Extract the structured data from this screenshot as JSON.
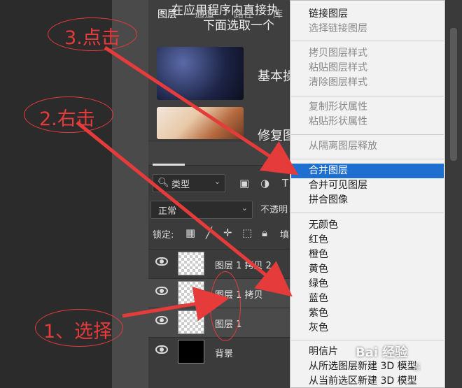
{
  "colors": {
    "annotation": "#e53b3b",
    "menu_highlight": "#1f6fd1",
    "menu_bg": "#f2f2f2",
    "panel_bg": "#3b3b3b"
  },
  "banner": {
    "line1": "在应用程序内直接执",
    "line2": "下面选取一个",
    "item1_label": "基本操",
    "item2_label": "修复图"
  },
  "layers_panel": {
    "tabs": [
      "图层",
      "通道",
      "路径",
      "库"
    ],
    "active_tab": "图层",
    "filter_label": "类型",
    "filter_icons": [
      "image-filter-icon",
      "adjustment-filter-icon",
      "type-filter-icon"
    ],
    "blend_mode": "正常",
    "opacity_label": "不透明",
    "lock_label": "锁定:",
    "lock_icons": [
      "lock-pixels-icon",
      "lock-brush-icon",
      "lock-position-icon",
      "lock-artboard-icon",
      "lock-all-icon"
    ],
    "fill_label": "填",
    "layers": [
      {
        "name": "图层 1 拷贝 2",
        "thumb": "transparent",
        "selected": false
      },
      {
        "name": "图层 1 拷贝",
        "thumb": "transparent",
        "selected": true
      },
      {
        "name": "图层 1",
        "thumb": "transparent",
        "selected": true
      },
      {
        "name": "背景",
        "thumb": "black",
        "selected": false
      }
    ]
  },
  "context_menu": {
    "groups": [
      [
        {
          "label": "链接图层",
          "enabled": true
        },
        {
          "label": "选择链接图层",
          "enabled": false
        }
      ],
      [
        {
          "label": "拷贝图层样式",
          "enabled": false
        },
        {
          "label": "粘贴图层样式",
          "enabled": false
        },
        {
          "label": "清除图层样式",
          "enabled": false
        }
      ],
      [
        {
          "label": "复制形状属性",
          "enabled": false
        },
        {
          "label": "粘贴形状属性",
          "enabled": false
        }
      ],
      [
        {
          "label": "从隔离图层释放",
          "enabled": false
        }
      ],
      [
        {
          "label": "合并图层",
          "enabled": true,
          "highlighted": true
        },
        {
          "label": "合并可见图层",
          "enabled": true
        },
        {
          "label": "拼合图像",
          "enabled": true
        }
      ],
      [
        {
          "label": "无颜色",
          "enabled": true
        },
        {
          "label": "红色",
          "enabled": true
        },
        {
          "label": "橙色",
          "enabled": true
        },
        {
          "label": "黄色",
          "enabled": true
        },
        {
          "label": "绿色",
          "enabled": true
        },
        {
          "label": "蓝色",
          "enabled": true
        },
        {
          "label": "紫色",
          "enabled": true
        },
        {
          "label": "灰色",
          "enabled": true
        }
      ],
      [
        {
          "label": "明信片",
          "enabled": true
        },
        {
          "label": "从所选图层新建 3D 模型",
          "enabled": true
        },
        {
          "label": "从当前选区新建 3D 模型",
          "enabled": true
        }
      ]
    ]
  },
  "annotations": {
    "step1": "1、选择",
    "step2": "2.右击",
    "step3": "3.点击"
  },
  "watermark": {
    "text": "Bai 经验",
    "sub": "百"
  }
}
